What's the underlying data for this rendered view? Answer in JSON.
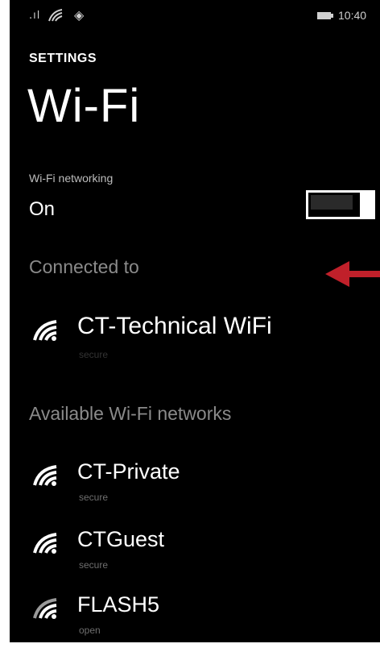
{
  "status_bar": {
    "signal_icon": "signal-bars-icon",
    "wifi_icon": "wifi-icon",
    "extra_icon": "location-icon",
    "battery_icon": "battery-icon",
    "time": "10:40"
  },
  "header": {
    "section": "SETTINGS",
    "title": "Wi-Fi"
  },
  "wifi_toggle": {
    "label": "Wi-Fi networking",
    "state": "On",
    "enabled": true
  },
  "connected": {
    "heading": "Connected to",
    "network": {
      "name": "CT-Technical WiFi",
      "status": "secure",
      "icon": "wifi-icon"
    }
  },
  "available": {
    "heading": "Available Wi-Fi networks",
    "networks": [
      {
        "name": "CT-Private",
        "status": "secure",
        "icon": "wifi-icon"
      },
      {
        "name": "CTGuest",
        "status": "secure",
        "icon": "wifi-icon"
      },
      {
        "name": "FLASH5",
        "status": "open",
        "icon": "wifi-icon"
      }
    ]
  },
  "annotation": {
    "icon": "red-arrow-icon",
    "color": "#c0202a"
  },
  "colors": {
    "background": "#000000",
    "text": "#ffffff",
    "muted": "#8a8a8a"
  }
}
